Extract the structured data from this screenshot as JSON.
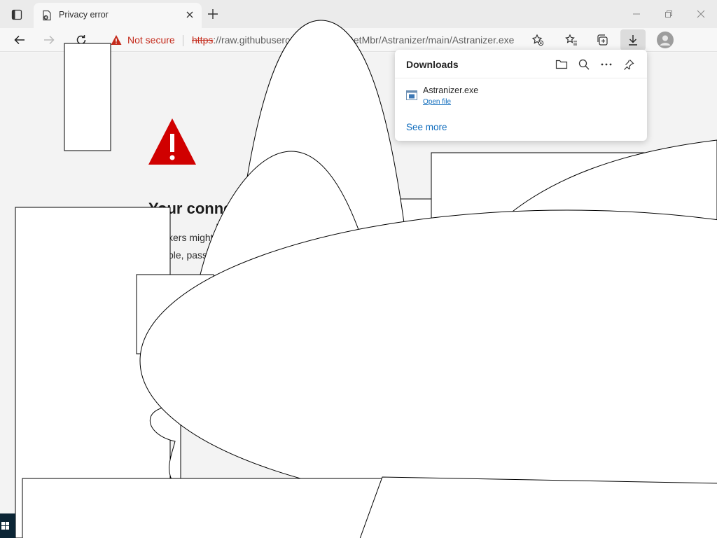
{
  "tab": {
    "title": "Privacy error"
  },
  "address_bar": {
    "security_label": "Not secure",
    "url_protocol": "https",
    "url_rest": "://raw.githubuserc",
    "url_tail": "GetMbr/Astranizer/main/Astranizer.exe"
  },
  "page": {
    "heading": "Your conne",
    "text_line_1": "kers might",
    "text_line_2": "ple, pass"
  },
  "downloads": {
    "title": "Downloads",
    "items": [
      {
        "file_name": "Astranizer.exe",
        "action": "Open file"
      }
    ],
    "see_more": "See more"
  },
  "colors": {
    "danger": "#c42b1c",
    "link": "#0f6cbd",
    "warning_red": "#d00000"
  }
}
